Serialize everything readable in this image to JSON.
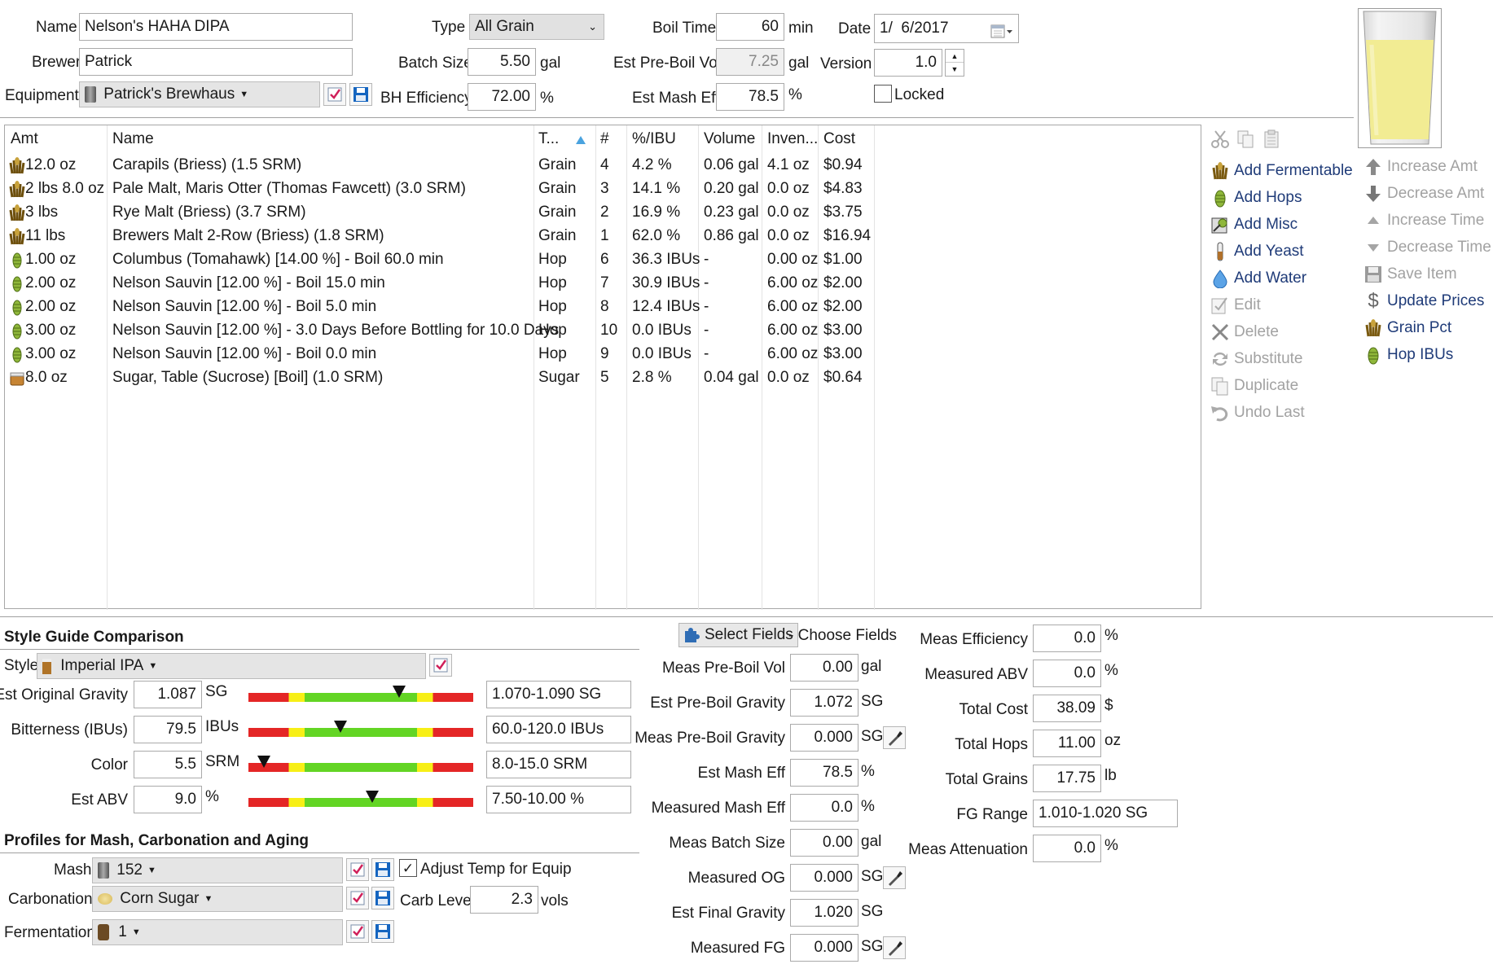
{
  "header": {
    "name_label": "Name",
    "name_value": "Nelson's HAHA DIPA",
    "brewer_label": "Brewer",
    "brewer_value": "Patrick",
    "equipment_label": "Equipment",
    "equipment_value": "Patrick's Brewhaus",
    "type_label": "Type",
    "type_value": "All Grain",
    "batch_size_label": "Batch Size",
    "batch_size_value": "5.50",
    "batch_size_unit": "gal",
    "bh_eff_label": "BH Efficiency",
    "bh_eff_value": "72.00",
    "bh_eff_unit": "%",
    "boil_time_label": "Boil Time",
    "boil_time_value": "60",
    "boil_time_unit": "min",
    "pre_boil_label": "Est Pre-Boil Vol",
    "pre_boil_value": "7.25",
    "pre_boil_unit": "gal",
    "mash_eff_label": "Est Mash Eff",
    "mash_eff_value": "78.5",
    "mash_eff_unit": "%",
    "date_label": "Date",
    "date_value": "1/  6/2017",
    "version_label": "Version",
    "version_value": "1.0",
    "locked_label": "Locked",
    "beer_color": "#f2ec93"
  },
  "grid": {
    "headers": [
      "Amt",
      "Name",
      "T...",
      "#",
      "%/IBU",
      "Volume",
      "Inven...",
      "Cost"
    ],
    "rows": [
      {
        "icon": "grain-icon",
        "amt": "12.0 oz",
        "name": "Carapils (Briess) (1.5 SRM)",
        "type": "Grain",
        "num": "4",
        "pct": "4.2 %",
        "volume": "0.06 gal",
        "inv": "4.1 oz",
        "cost": "$0.94"
      },
      {
        "icon": "grain-icon",
        "amt": "2 lbs 8.0 oz",
        "name": "Pale Malt, Maris Otter (Thomas Fawcett) (3.0 SRM)",
        "type": "Grain",
        "num": "3",
        "pct": "14.1 %",
        "volume": "0.20 gal",
        "inv": "0.0 oz",
        "cost": "$4.83"
      },
      {
        "icon": "grain-icon",
        "amt": "3 lbs",
        "name": "Rye Malt (Briess) (3.7 SRM)",
        "type": "Grain",
        "num": "2",
        "pct": "16.9 %",
        "volume": "0.23 gal",
        "inv": "0.0 oz",
        "cost": "$3.75"
      },
      {
        "icon": "grain-icon",
        "amt": "11 lbs",
        "name": "Brewers Malt 2-Row (Briess) (1.8 SRM)",
        "type": "Grain",
        "num": "1",
        "pct": "62.0 %",
        "volume": "0.86 gal",
        "inv": "0.0 oz",
        "cost": "$16.94"
      },
      {
        "icon": "hop-icon",
        "amt": "1.00 oz",
        "name": "Columbus (Tomahawk) [14.00 %] - Boil 60.0 min",
        "type": "Hop",
        "num": "6",
        "pct": "36.3 IBUs",
        "volume": "-",
        "inv": "0.00 oz",
        "cost": "$1.00"
      },
      {
        "icon": "hop-icon",
        "amt": "2.00 oz",
        "name": "Nelson Sauvin [12.00 %] - Boil 15.0 min",
        "type": "Hop",
        "num": "7",
        "pct": "30.9 IBUs",
        "volume": "-",
        "inv": "6.00 oz",
        "cost": "$2.00"
      },
      {
        "icon": "hop-icon",
        "amt": "2.00 oz",
        "name": "Nelson Sauvin [12.00 %] - Boil 5.0 min",
        "type": "Hop",
        "num": "8",
        "pct": "12.4 IBUs",
        "volume": "-",
        "inv": "6.00 oz",
        "cost": "$2.00"
      },
      {
        "icon": "hop-icon",
        "amt": "3.00 oz",
        "name": "Nelson Sauvin [12.00 %] - 3.0 Days Before Bottling for 10.0 Days",
        "type": "Hop",
        "num": "10",
        "pct": "0.0 IBUs",
        "volume": "-",
        "inv": "6.00 oz",
        "cost": "$3.00"
      },
      {
        "icon": "hop-icon",
        "amt": "3.00 oz",
        "name": "Nelson Sauvin [12.00 %] - Boil 0.0 min",
        "type": "Hop",
        "num": "9",
        "pct": "0.0 IBUs",
        "volume": "-",
        "inv": "6.00 oz",
        "cost": "$3.00"
      },
      {
        "icon": "sugar-icon",
        "amt": "8.0 oz",
        "name": "Sugar, Table (Sucrose) [Boil] (1.0 SRM)",
        "type": "Sugar",
        "num": "5",
        "pct": "2.8 %",
        "volume": "0.04 gal",
        "inv": "0.0 oz",
        "cost": "$0.64"
      }
    ]
  },
  "actions": {
    "add_fermentable": "Add Fermentable",
    "add_hops": "Add Hops",
    "add_misc": "Add Misc",
    "add_yeast": "Add Yeast",
    "add_water": "Add Water",
    "edit": "Edit",
    "delete": "Delete",
    "substitute": "Substitute",
    "duplicate": "Duplicate",
    "undo_last": "Undo Last",
    "increase_amt": "Increase Amt",
    "decrease_amt": "Decrease Amt",
    "increase_time": "Increase Time",
    "decrease_time": "Decrease Time",
    "save_item": "Save Item",
    "update_prices": "Update Prices",
    "grain_pct": "Grain Pct",
    "hop_ibus": "Hop IBUs"
  },
  "style": {
    "title": "Style Guide Comparison",
    "style_label": "Style",
    "style_value": "Imperial IPA",
    "rows": [
      {
        "label": "Est Original Gravity",
        "value": "1.087",
        "unit": "SG",
        "range": "1.070-1.090 SG",
        "position": 0.67
      },
      {
        "label": "Bitterness (IBUs)",
        "value": "79.5",
        "unit": "IBUs",
        "range": "60.0-120.0 IBUs",
        "position": 0.41
      },
      {
        "label": "Color",
        "value": "5.5",
        "unit": "SRM",
        "range": "8.0-15.0 SRM",
        "position": 0.07
      },
      {
        "label": "Est ABV",
        "value": "9.0",
        "unit": "%",
        "range": "7.50-10.00 %",
        "position": 0.55
      }
    ]
  },
  "profiles": {
    "title": "Profiles for Mash, Carbonation and Aging",
    "mash_label": "Mash",
    "mash_value": "152",
    "adjust_label": "Adjust Temp for Equip",
    "carb_label": "Carbonation",
    "carb_value": "Corn Sugar",
    "carb_level_label": "Carb Level",
    "carb_level_value": "2.3",
    "carb_level_unit": "vols",
    "ferm_label": "Fermentation",
    "ferm_value": "1"
  },
  "measurements": {
    "select_fields": "Select Fields",
    "choose_fields": "- Choose Fields",
    "rows": [
      {
        "label": "Meas Pre-Boil Vol",
        "value": "0.00",
        "unit": "gal",
        "tool": false
      },
      {
        "label": "Est Pre-Boil Gravity",
        "value": "1.072",
        "unit": "SG",
        "tool": false
      },
      {
        "label": "Meas Pre-Boil Gravity",
        "value": "0.000",
        "unit": "SG",
        "tool": true
      },
      {
        "label": "Est Mash Eff",
        "value": "78.5",
        "unit": "%",
        "tool": false
      },
      {
        "label": "Measured Mash Eff",
        "value": "0.0",
        "unit": "%",
        "tool": false
      },
      {
        "label": "Meas Batch Size",
        "value": "0.00",
        "unit": "gal",
        "tool": false
      },
      {
        "label": "Measured OG",
        "value": "0.000",
        "unit": "SG",
        "tool": true
      },
      {
        "label": "Est Final Gravity",
        "value": "1.020",
        "unit": "SG",
        "tool": false
      },
      {
        "label": "Measured FG",
        "value": "0.000",
        "unit": "SG",
        "tool": true
      }
    ]
  },
  "stats": {
    "rows": [
      {
        "label": "Meas Efficiency",
        "value": "0.0",
        "unit": "%"
      },
      {
        "label": "Measured ABV",
        "value": "0.0",
        "unit": "%"
      },
      {
        "label": "Total Cost",
        "value": "38.09",
        "unit": "$"
      },
      {
        "label": "Total Hops",
        "value": "11.00",
        "unit": "oz"
      },
      {
        "label": "Total Grains",
        "value": "17.75",
        "unit": "lb"
      },
      {
        "label": "FG Range",
        "value": "1.010-1.020 SG",
        "unit": ""
      },
      {
        "label": "Meas Attenuation",
        "value": "0.0",
        "unit": "%"
      }
    ]
  }
}
